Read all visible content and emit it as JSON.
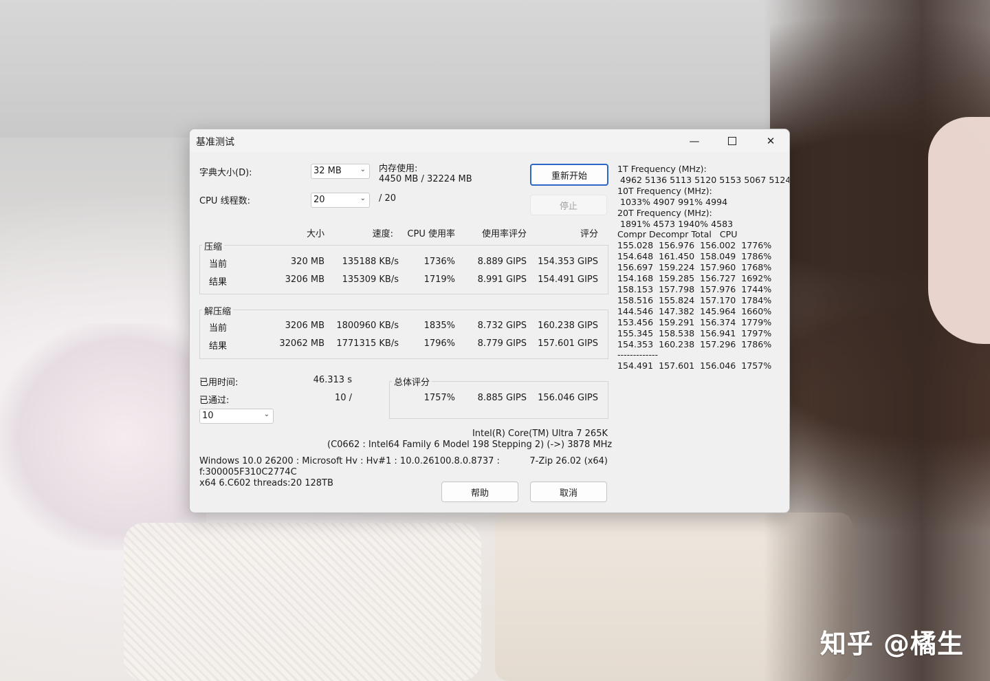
{
  "window": {
    "title": "基准测试"
  },
  "settings": {
    "dict_label": "字典大小(D):",
    "dict_value": "32 MB",
    "threads_label": "CPU 线程数:",
    "threads_value": "20",
    "threads_total": "/ 20",
    "memory_label": "内存使用:",
    "memory_value": "4450 MB / 32224 MB"
  },
  "buttons": {
    "restart": "重新开始",
    "stop": "停止",
    "help": "帮助",
    "cancel": "取消"
  },
  "table": {
    "headers": [
      "大小",
      "速度:",
      "CPU 使用率",
      "使用率评分",
      "评分"
    ],
    "compress": {
      "label": "压缩",
      "rows": [
        {
          "name": "当前",
          "size": "320 MB",
          "speed": "135188 KB/s",
          "usage": "1736%",
          "rating": "8.889 GIPS",
          "score": "154.353 GIPS"
        },
        {
          "name": "结果",
          "size": "3206 MB",
          "speed": "135309 KB/s",
          "usage": "1719%",
          "rating": "8.991 GIPS",
          "score": "154.491 GIPS"
        }
      ]
    },
    "decompress": {
      "label": "解压缩",
      "rows": [
        {
          "name": "当前",
          "size": "3206 MB",
          "speed": "1800960 KB/s",
          "usage": "1835%",
          "rating": "8.732 GIPS",
          "score": "160.238 GIPS"
        },
        {
          "name": "结果",
          "size": "32062 MB",
          "speed": "1771315 KB/s",
          "usage": "1796%",
          "rating": "8.779 GIPS",
          "score": "157.601 GIPS"
        }
      ]
    }
  },
  "stats": {
    "elapsed_label": "已用时间:",
    "elapsed_value": "46.313 s",
    "passed_label": "已通过:",
    "passed_value": "10 /",
    "passes_select": "10"
  },
  "total": {
    "label": "总体评分",
    "usage": "1757%",
    "rating": "8.885 GIPS",
    "score": "156.046 GIPS"
  },
  "cpu_info": {
    "line1": "Intel(R) Core(TM) Ultra 7 265K",
    "line2": "(C0662 : Intel64 Family 6 Model 198 Stepping 2) (->) 3878 MHz",
    "version": "7-Zip 26.02 (x64)"
  },
  "os_info": {
    "line1": "Windows 10.0 26200 : Microsoft Hv : Hv#1 : 10.0.26100.8.0.8737 :",
    "line2": "f:300005F310C2774C",
    "line3": "x64 6.C602 threads:20 128TB"
  },
  "log_lines": [
    "1T Frequency (MHz):",
    " 4962 5136 5113 5120 5153 5067 5124",
    "10T Frequency (MHz):",
    " 1033% 4907 991% 4994",
    "20T Frequency (MHz):",
    " 1891% 4573 1940% 4583",
    "Compr Decompr Total   CPU",
    "155.028  156.976  156.002  1776%",
    "154.648  161.450  158.049  1786%",
    "156.697  159.224  157.960  1768%",
    "154.168  159.285  156.727  1692%",
    "158.153  157.798  157.976  1744%",
    "158.516  155.824  157.170  1784%",
    "144.546  147.382  145.964  1660%",
    "153.456  159.291  156.374  1779%",
    "155.345  158.538  156.941  1797%",
    "154.353  160.238  157.296  1786%",
    "-------------",
    "154.491  157.601  156.046  1757%"
  ],
  "watermark": "知乎 @橘生"
}
